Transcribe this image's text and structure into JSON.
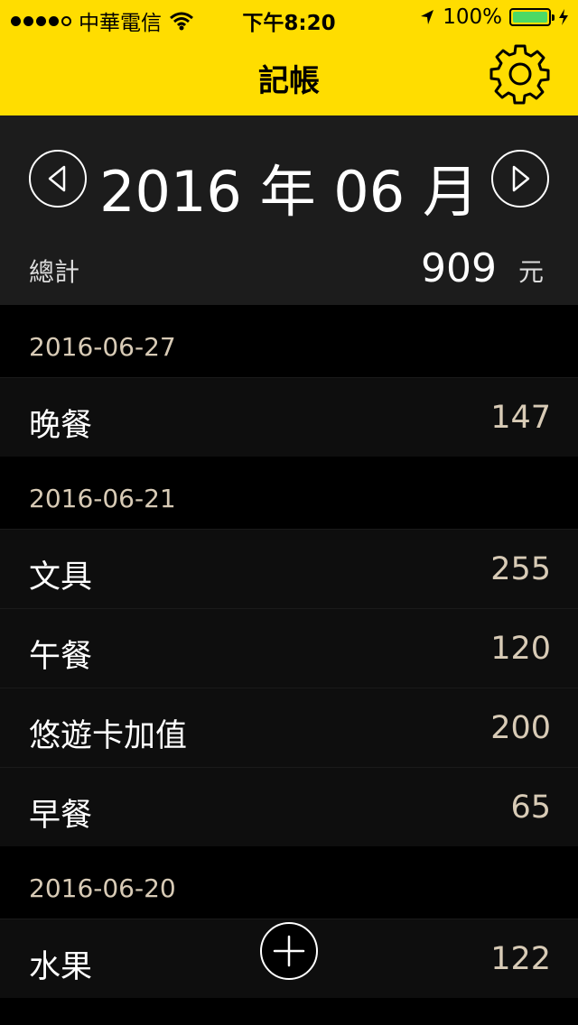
{
  "status_bar": {
    "carrier": "中華電信",
    "time": "下午8:20",
    "battery_percent": "100%",
    "battery_color": "#4CD964"
  },
  "header": {
    "title": "記帳",
    "background_color": "#FFDD00",
    "settings_icon": "gear-icon"
  },
  "month_selector": {
    "label": "2016 年 06 月",
    "prev_icon": "triangle-left-icon",
    "next_icon": "triangle-right-icon"
  },
  "summary": {
    "label": "總計",
    "value": "909",
    "unit": "元"
  },
  "groups": [
    {
      "date": "2016-06-27",
      "items": [
        {
          "name": "晚餐",
          "amount": "147"
        }
      ]
    },
    {
      "date": "2016-06-21",
      "items": [
        {
          "name": "文具",
          "amount": "255"
        },
        {
          "name": "午餐",
          "amount": "120"
        },
        {
          "name": "悠遊卡加值",
          "amount": "200"
        },
        {
          "name": "早餐",
          "amount": "65"
        }
      ]
    },
    {
      "date": "2016-06-20",
      "items": [
        {
          "name": "水果",
          "amount": "122"
        }
      ]
    }
  ],
  "add_button": {
    "icon": "plus-icon"
  },
  "colors": {
    "accent": "#FFDD00",
    "amount_text": "#D8CBB6"
  }
}
